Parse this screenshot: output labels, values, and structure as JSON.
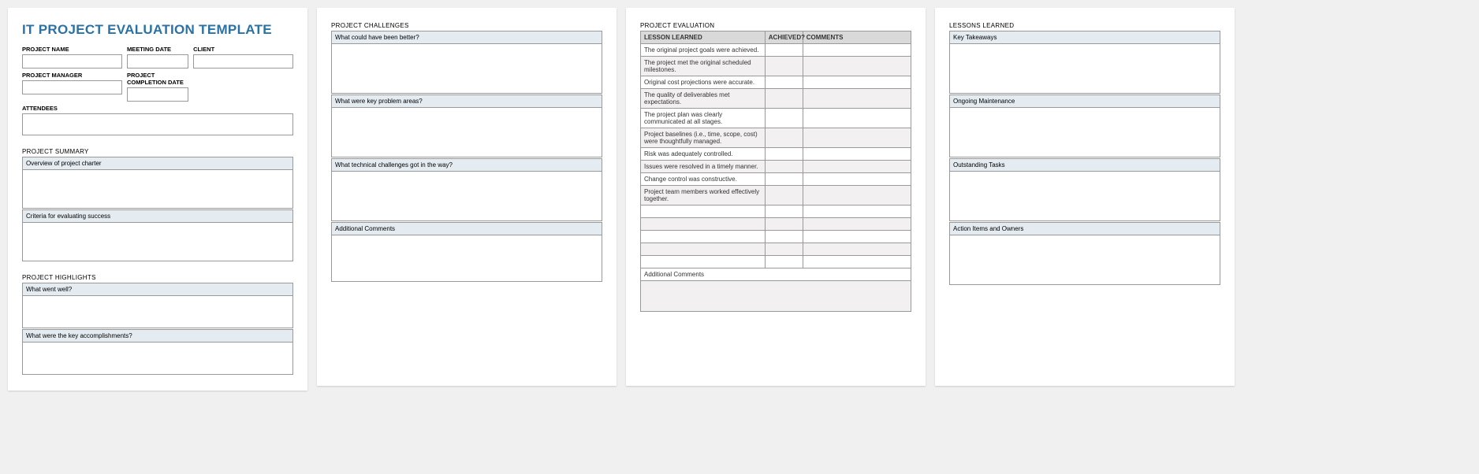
{
  "title": "IT PROJECT EVALUATION TEMPLATE",
  "fields": {
    "project_name": "PROJECT NAME",
    "meeting_date": "MEETING DATE",
    "client": "CLIENT",
    "project_manager": "PROJECT MANAGER",
    "project_completion_date": "PROJECT COMPLETION DATE",
    "attendees": "ATTENDEES"
  },
  "sections": {
    "project_summary": "PROJECT SUMMARY",
    "overview_charter": "Overview of project charter",
    "criteria_success": "Criteria for evaluating success",
    "project_highlights": "PROJECT HIGHLIGHTS",
    "what_went_well": "What went well?",
    "key_accomplishments": "What were the key accomplishments?",
    "project_challenges": "PROJECT CHALLENGES",
    "could_better": "What could have been better?",
    "key_problems": "What were key problem areas?",
    "tech_challenges": "What technical challenges got in the way?",
    "additional_comments": "Additional Comments",
    "project_evaluation": "PROJECT EVALUATION",
    "lessons_learned": "LESSONS LEARNED",
    "key_takeaways": "Key Takeaways",
    "ongoing_maintenance": "Ongoing Maintenance",
    "outstanding_tasks": "Outstanding Tasks",
    "action_items": "Action Items and Owners"
  },
  "eval_headers": {
    "lesson": "LESSON LEARNED",
    "achieved": "ACHIEVED?",
    "comments": "COMMENTS"
  },
  "eval_rows": [
    "The original project goals were achieved.",
    "The project met the original scheduled milestones.",
    "Original cost projections were accurate.",
    "The quality of deliverables met expectations.",
    "The project plan was clearly communicated at all stages.",
    "Project baselines (i.e., time, scope, cost) were thoughtfully managed.",
    "Risk was adequately controlled.",
    "Issues were resolved in a timely manner.",
    "Change control was constructive.",
    "Project team members worked effectively together.",
    "",
    "",
    "",
    "",
    ""
  ]
}
